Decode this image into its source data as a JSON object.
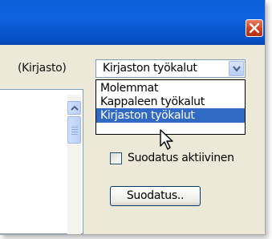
{
  "window": {
    "close_icon": "close-icon",
    "colors": {
      "titlebar": "#0a5fd8",
      "selection": "#316ac5",
      "close": "#cf3c18"
    }
  },
  "library_label": "(Kirjasto)",
  "tools_combo": {
    "selected": "Kirjaston työkalut",
    "options": [
      "Molemmat",
      "Kappaleen työkalut",
      "Kirjaston työkalut"
    ],
    "highlighted_index": 2
  },
  "filter_checkbox": {
    "label": "Suodatus aktiivinen",
    "checked": false
  },
  "filter_button": {
    "label": "Suodatus.."
  }
}
